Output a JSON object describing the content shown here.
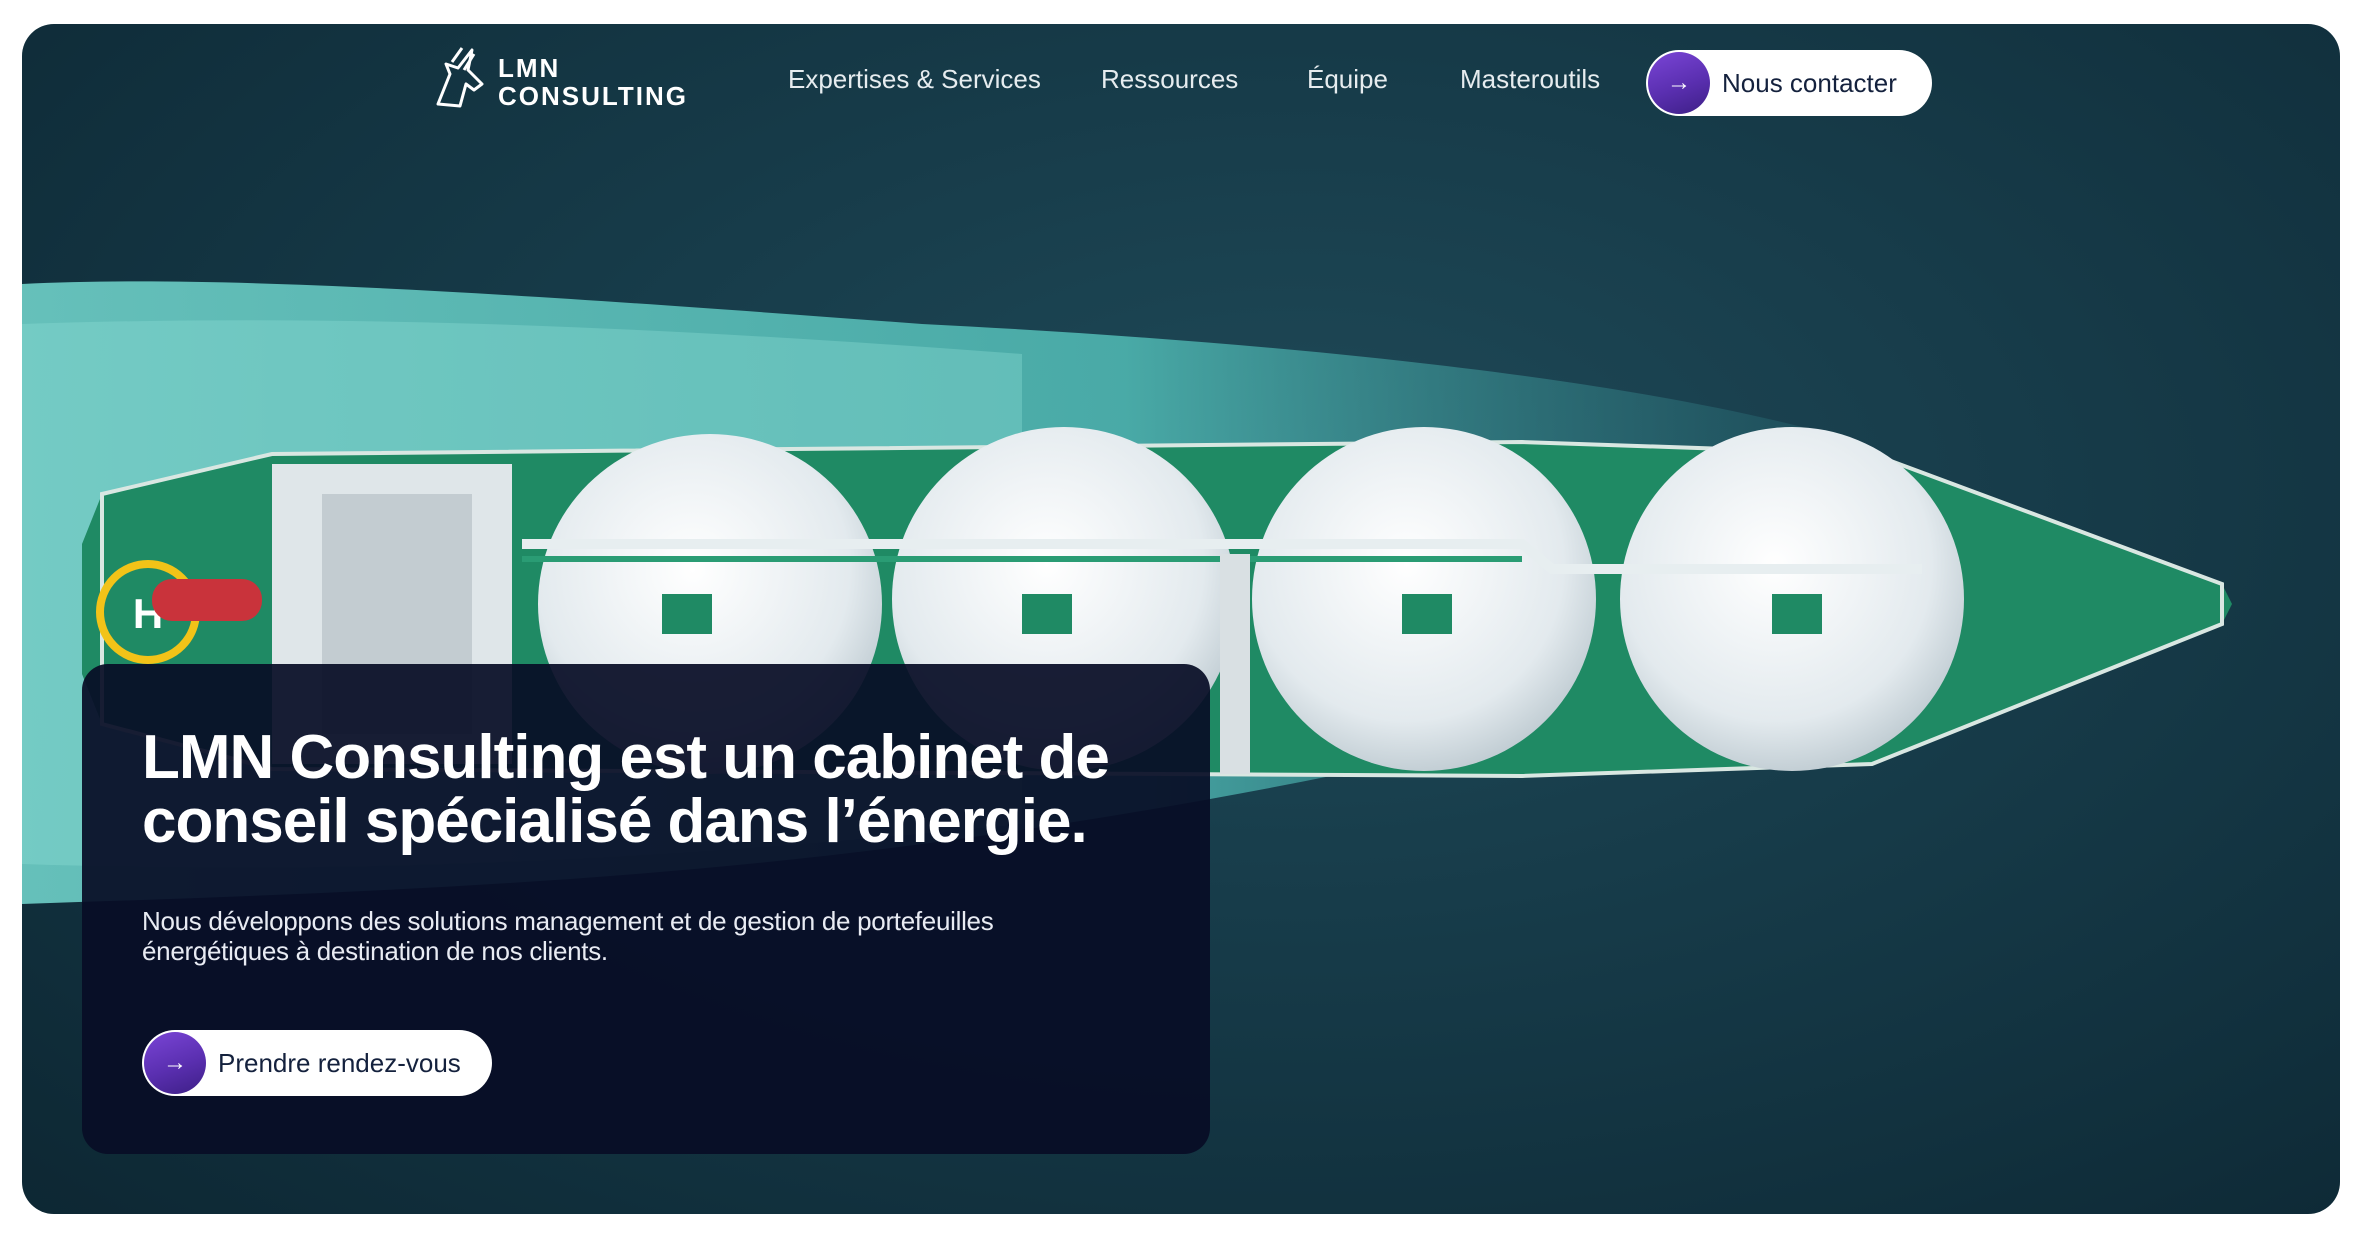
{
  "logo": {
    "line1": "LMN",
    "line2": "CONSULTING",
    "icon": "lmn-knight-logo-icon"
  },
  "nav": {
    "items": [
      {
        "label": "Expertises & Services"
      },
      {
        "label": "Ressources"
      },
      {
        "label": "Équipe"
      },
      {
        "label": "Masteroutils"
      }
    ],
    "contact": {
      "label": "Nous contacter",
      "icon": "arrow-right-icon"
    }
  },
  "hero": {
    "image": "lng-carrier-ship-aerial",
    "heliport_letter": "H",
    "headline": "LMN Consulting est un cabinet de conseil spécialisé dans l’énergie.",
    "subtext": "Nous développons des solutions management et de gestion de portefeuilles énergétiques à destination de nos clients.",
    "cta": {
      "label": "Prendre rendez-vous",
      "icon": "arrow-right-icon"
    }
  },
  "colors": {
    "sea": "#173c4a",
    "card": "#080d26",
    "accent_purple": "#5a2fb0",
    "hull_green": "#1f8a64",
    "tank_white": "#e9eff2",
    "wake": "#5fc4bf"
  }
}
